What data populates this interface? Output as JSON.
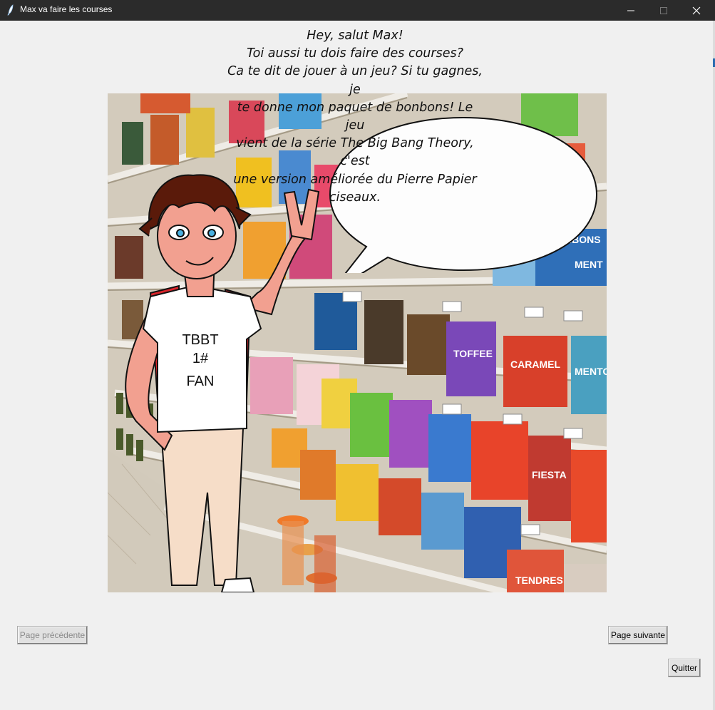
{
  "window": {
    "title": "Max va faire les courses",
    "controls": [
      "minimize",
      "maximize",
      "close"
    ]
  },
  "comic": {
    "speech_lines": [
      "Hey, salut Max!",
      "Toi aussi tu dois faire des courses?",
      "Ca te dit de jouer à un jeu? Si tu gagnes, je",
      "te donne mon paquet de bonbons! Le jeu",
      "vient de la série The Big Bang Theory, c'est",
      "une version améliorée du Pierre Papier",
      "ciseaux."
    ],
    "shirt_text": [
      "TBBT",
      "1#",
      "FAN"
    ],
    "packages": [
      "TOFFEE",
      "CARAMEL",
      "FIESTA",
      "MENT",
      "BONBONS",
      "MENTOS",
      "TENDRES"
    ]
  },
  "buttons": {
    "previous": "Page précédente",
    "next": "Page suivante",
    "quit": "Quitter"
  }
}
